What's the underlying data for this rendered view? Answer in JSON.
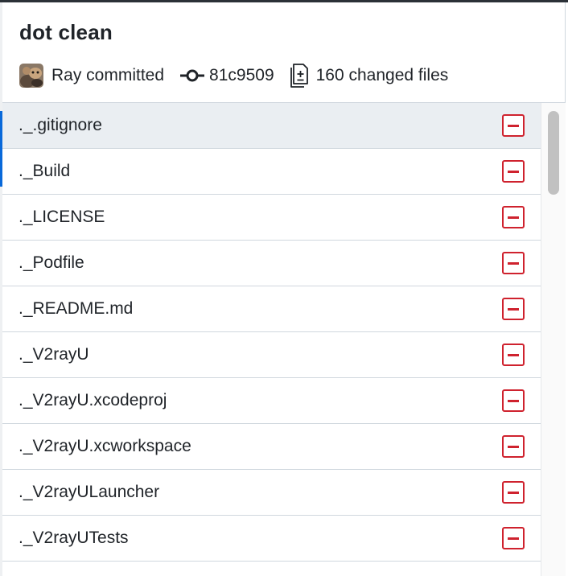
{
  "commit": {
    "title": "dot clean",
    "author_action": "Ray committed",
    "sha": "81c9509",
    "changed_files": "160 changed files"
  },
  "icons": {
    "avatar": "avatar-image",
    "commit": "git-commit-icon",
    "files": "file-diff-icon",
    "deleted": "file-removed-icon"
  },
  "colors": {
    "deleted": "#cf222e",
    "selected_row": "#eaeef2",
    "accent": "#0969da"
  },
  "files": [
    {
      "name": "._.gitignore",
      "status": "deleted"
    },
    {
      "name": "._Build",
      "status": "deleted"
    },
    {
      "name": "._LICENSE",
      "status": "deleted"
    },
    {
      "name": "._Podfile",
      "status": "deleted"
    },
    {
      "name": "._README.md",
      "status": "deleted"
    },
    {
      "name": "._V2rayU",
      "status": "deleted"
    },
    {
      "name": "._V2rayU.xcodeproj",
      "status": "deleted"
    },
    {
      "name": "._V2rayU.xcworkspace",
      "status": "deleted"
    },
    {
      "name": "._V2rayULauncher",
      "status": "deleted"
    },
    {
      "name": "._V2rayUTests",
      "status": "deleted"
    }
  ],
  "selected_index": 0
}
